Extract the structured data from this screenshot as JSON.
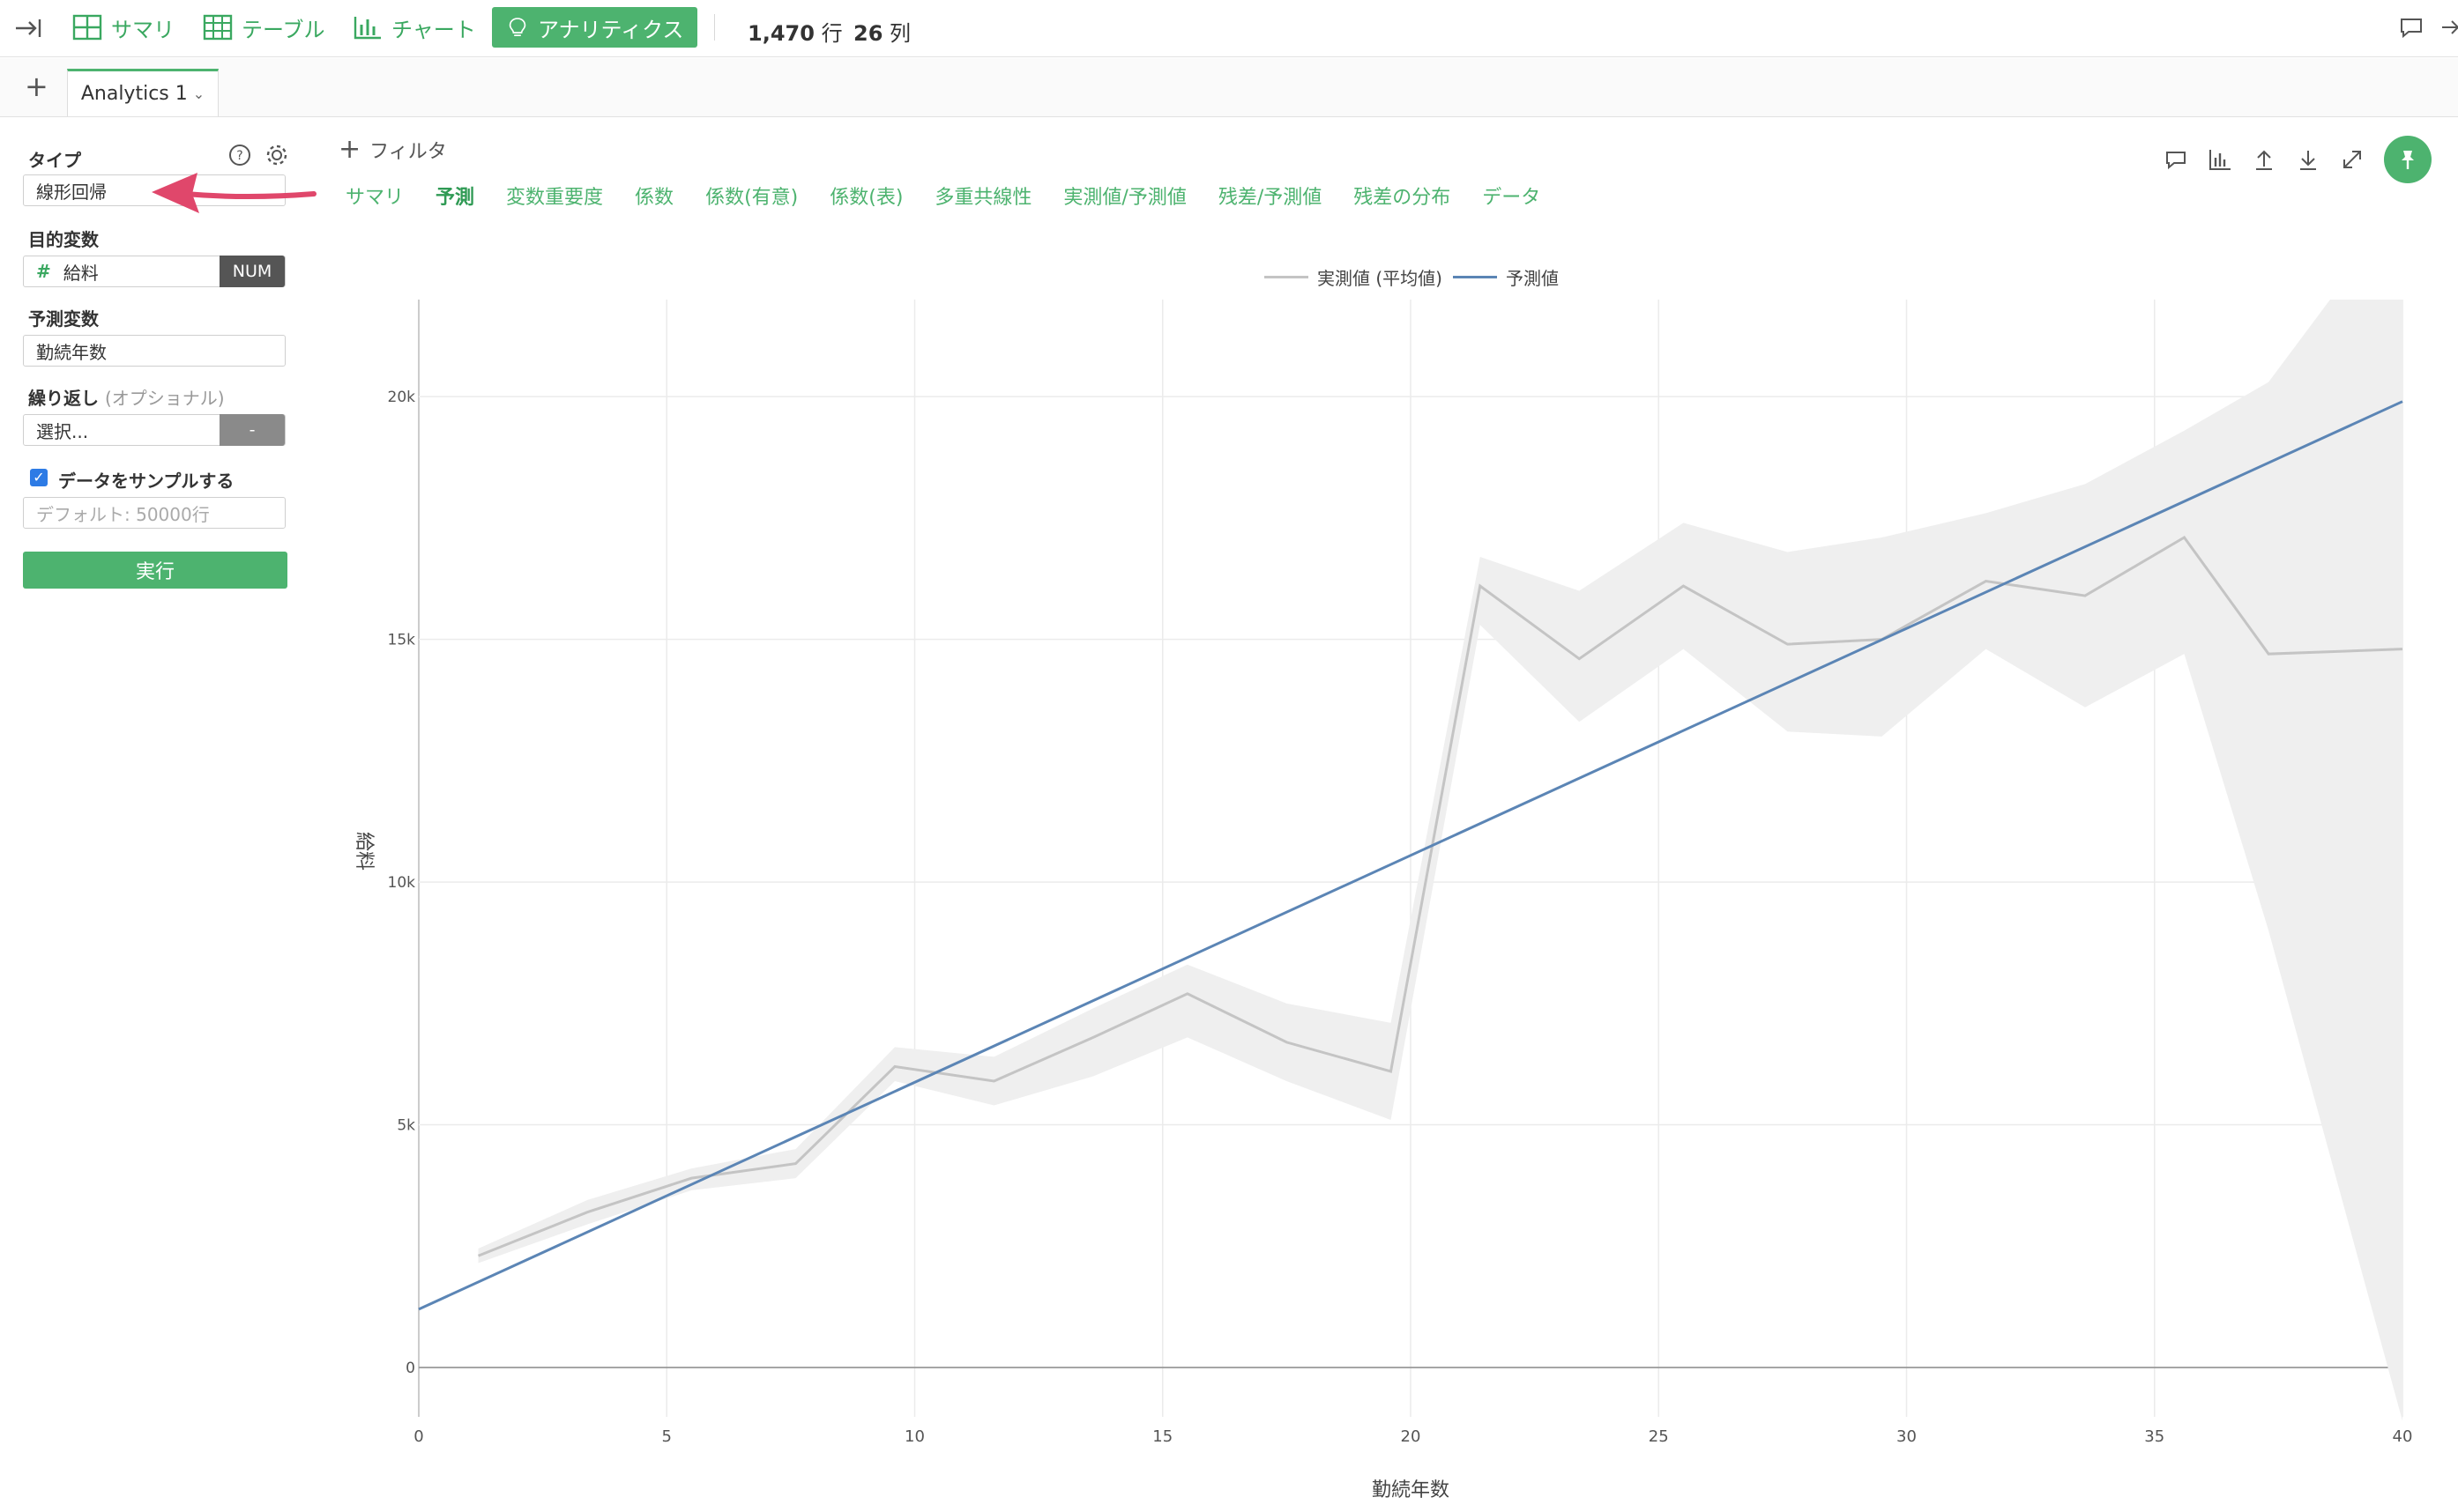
{
  "toolbar": {
    "summary": "サマリ",
    "table": "テーブル",
    "chart": "チャート",
    "analytics": "アナリティクス",
    "rows_num": "1,470",
    "rows_unit": "行",
    "cols_num": "26",
    "cols_unit": "列"
  },
  "tabs": {
    "add": "+",
    "active_tab": "Analytics 1"
  },
  "sidebar": {
    "type_label": "タイプ",
    "type_value": "線形回帰",
    "target_label": "目的変数",
    "target_value": "給料",
    "target_badge": "NUM",
    "predictor_label": "予測変数",
    "predictor_value": "勤続年数",
    "repeat_label": "繰り返し",
    "repeat_optional": "(オプショナル)",
    "repeat_placeholder": "選択...",
    "repeat_badge": "-",
    "sample_label": "データをサンプルする",
    "sample_placeholder": "デフォルト: 50000行",
    "run_button": "実行"
  },
  "main": {
    "filter": "フィルタ",
    "subtabs": [
      "サマリ",
      "予測",
      "変数重要度",
      "係数",
      "係数(有意)",
      "係数(表)",
      "多重共線性",
      "実測値/予測値",
      "残差/予測値",
      "残差の分布",
      "データ"
    ],
    "active_subtab": "予測"
  },
  "chart_data": {
    "type": "line",
    "xlabel": "勤続年数",
    "ylabel": "給料",
    "xlim": [
      0,
      40
    ],
    "ylim": [
      0,
      22000
    ],
    "x_ticks": [
      "0",
      "5",
      "10",
      "15",
      "20",
      "25",
      "30",
      "35",
      "40"
    ],
    "y_ticks": [
      "0",
      "5k",
      "10k",
      "15k",
      "20k"
    ],
    "legend_position": "top-center",
    "series": [
      {
        "name": "実測値 (平均値)",
        "color": "#c4c4c4",
        "x": [
          1.2,
          3.4,
          5.5,
          7.6,
          9.6,
          11.6,
          13.6,
          15.5,
          17.5,
          19.6,
          21.4,
          23.4,
          25.5,
          27.6,
          29.5,
          31.6,
          33.6,
          35.6,
          37.3,
          40
        ],
        "y": [
          2300,
          3200,
          3900,
          4200,
          6200,
          5900,
          6800,
          7700,
          6700,
          6100,
          16100,
          14600,
          16100,
          14900,
          15000,
          16200,
          15900,
          17100,
          14700,
          14800
        ],
        "band_upper": [
          2450,
          3450,
          4100,
          4500,
          6600,
          6400,
          7400,
          8300,
          7500,
          7100,
          16700,
          16000,
          17400,
          16800,
          17100,
          17600,
          18200,
          19300,
          20300,
          24000
        ],
        "band_lower": [
          2150,
          2950,
          3650,
          3900,
          5900,
          5400,
          6000,
          6800,
          5900,
          5100,
          15300,
          13300,
          14800,
          13100,
          13000,
          14800,
          13600,
          14700,
          9000,
          -1100
        ]
      },
      {
        "name": "予測値",
        "color": "#5b85b5",
        "x": [
          0,
          40
        ],
        "y": [
          1200,
          19900
        ]
      }
    ]
  }
}
